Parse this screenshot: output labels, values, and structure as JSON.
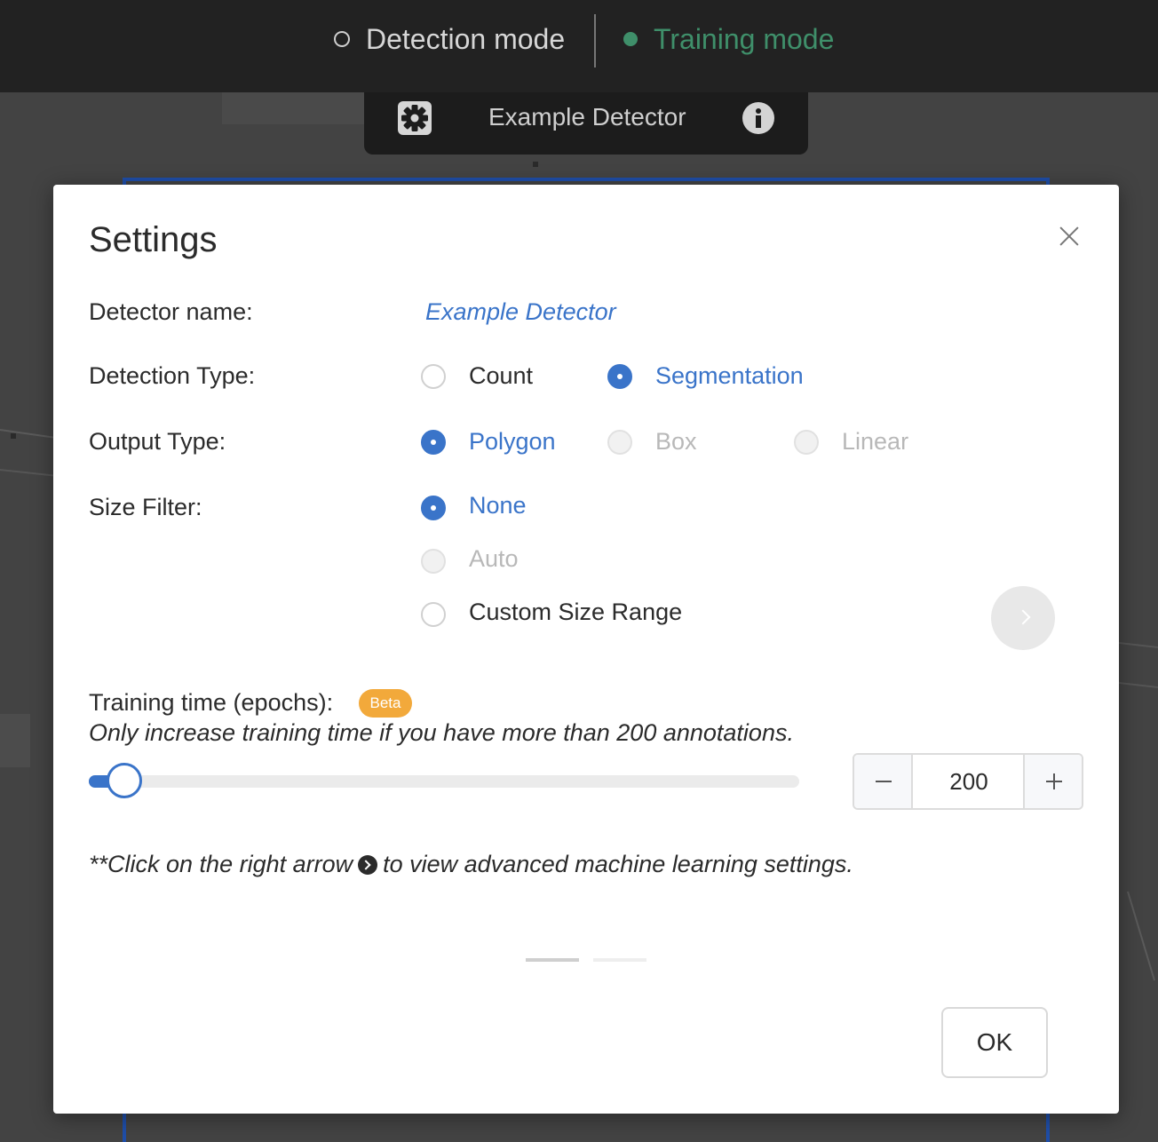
{
  "topbar": {
    "detection_mode_label": "Detection mode",
    "training_mode_label": "Training mode",
    "active_mode": "training",
    "active_color": "#3f8f6a"
  },
  "detector_bar": {
    "settings_icon": "gear-icon",
    "title": "Example Detector",
    "info_icon": "info-icon"
  },
  "modal": {
    "title": "Settings",
    "close_icon": "close-icon",
    "detector_name": {
      "label": "Detector name:",
      "value": "Example Detector"
    },
    "detection_type": {
      "label": "Detection Type:",
      "options": [
        {
          "label": "Count",
          "selected": false,
          "disabled": false
        },
        {
          "label": "Segmentation",
          "selected": true,
          "disabled": false
        }
      ]
    },
    "output_type": {
      "label": "Output Type:",
      "options": [
        {
          "label": "Polygon",
          "selected": true,
          "disabled": false
        },
        {
          "label": "Box",
          "selected": false,
          "disabled": true
        },
        {
          "label": "Linear",
          "selected": false,
          "disabled": true
        }
      ]
    },
    "size_filter": {
      "label": "Size Filter:",
      "options": [
        {
          "label": "None",
          "selected": true,
          "disabled": false
        },
        {
          "label": "Auto",
          "selected": false,
          "disabled": true
        },
        {
          "label": "Custom Size Range",
          "selected": false,
          "disabled": false
        }
      ]
    },
    "next_icon": "chevron-right-icon",
    "training_time": {
      "label": "Training time (epochs):",
      "badge": "Beta",
      "hint": "Only increase training time if you have more than 200 annotations.",
      "value": "200",
      "slider_fraction": 0.05
    },
    "advanced_note": {
      "before": "**Click on the right arrow",
      "after": "to view advanced machine learning settings."
    },
    "pagination": {
      "current": 1,
      "total": 2
    },
    "ok_label": "OK",
    "accent_color": "#3a74c9",
    "badge_color": "#f2a93b"
  }
}
